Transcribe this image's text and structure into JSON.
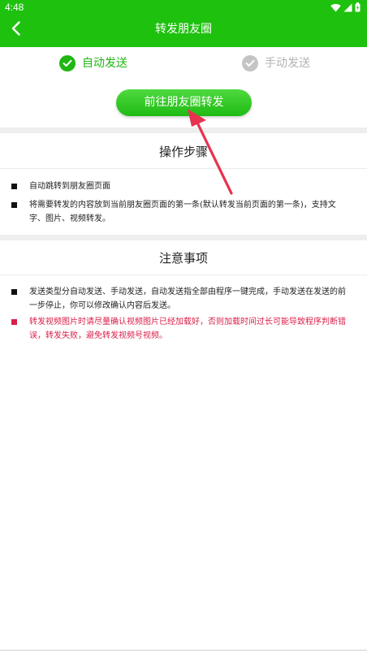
{
  "status_bar": {
    "time": "4:48",
    "icons": [
      "wifi-icon",
      "signal-icon",
      "battery-icon"
    ]
  },
  "header": {
    "title": "转发朋友圈",
    "back_icon": "chevron-left-icon",
    "background_color": "#1fc10f"
  },
  "modes": {
    "auto": {
      "label": "自动发送",
      "selected": true,
      "color": "#1fb713"
    },
    "manual": {
      "label": "手动发送",
      "selected": false,
      "color": "#b3b3b3"
    }
  },
  "action_button": {
    "label": "前往朋友圈转发"
  },
  "steps": {
    "title": "操作步骤",
    "items": [
      "自动跳转到朋友圈页面",
      "将需要转发的内容放到当前朋友圈页面的第一条(默认转发当前页面的第一条)，支持文字、图片、视频转发。"
    ]
  },
  "notes": {
    "title": "注意事项",
    "items": [
      "发送类型分自动发送、手动发送，自动发送指全部由程序一键完成，手动发送在发送的前一步停止，你可以修改确认内容后发送。"
    ],
    "warning": "转发视频图片时请尽量确认视频图片已经加载好，否则加载时间过长可能导致程序判断错误，转发失败，避免转发视频号视频。",
    "warning_color": "#d9204a"
  },
  "annotation": {
    "arrow_color": "#e8324f"
  }
}
